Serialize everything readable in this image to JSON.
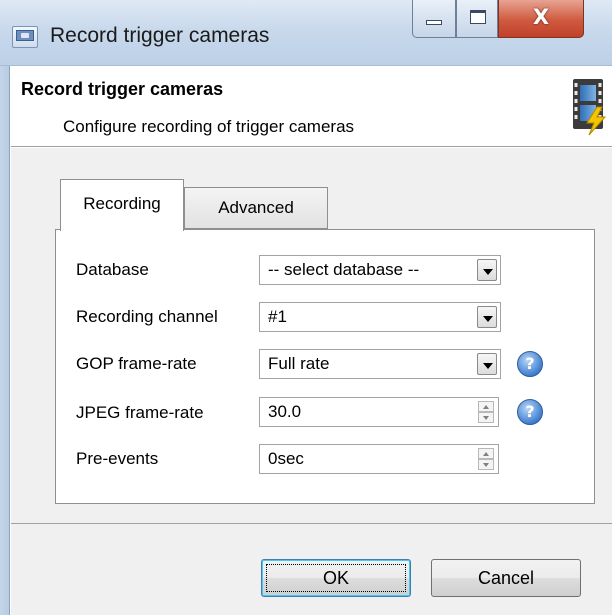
{
  "window": {
    "title": "Record trigger cameras",
    "controls": {
      "minimize": "minimize",
      "maximize": "maximize",
      "close": "X"
    }
  },
  "header": {
    "title": "Record trigger cameras",
    "subtitle": "Configure recording of trigger cameras",
    "icon": "film-lightning-icon"
  },
  "tabs": [
    {
      "label": "Recording",
      "selected": true
    },
    {
      "label": "Advanced",
      "selected": false
    }
  ],
  "form": {
    "database": {
      "label": "Database",
      "value": "-- select database --"
    },
    "recording_channel": {
      "label": "Recording channel",
      "value": "#1"
    },
    "gop_frame_rate": {
      "label": "GOP frame-rate",
      "value": "Full rate",
      "help_icon": "?"
    },
    "jpeg_frame_rate": {
      "label": "JPEG frame-rate",
      "value": "30.0",
      "help_icon": "?"
    },
    "pre_events": {
      "label": "Pre-events",
      "value": "0sec"
    }
  },
  "buttons": {
    "ok": "OK",
    "cancel": "Cancel"
  },
  "colors": {
    "title_bar": "#c9d9ec",
    "close_button": "#cf5a3f",
    "dialog_background": "#f0f0f0",
    "help_icon": "#3f7fd1"
  }
}
